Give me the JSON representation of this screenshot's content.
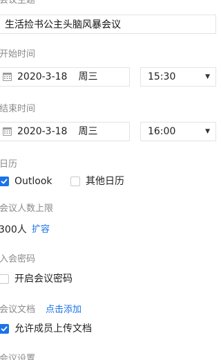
{
  "topic": {
    "label": "会议主题",
    "value": "生活捡书公主头脑风暴会议"
  },
  "start": {
    "label": "开始时间",
    "date": "2020-3-18",
    "weekday": "周三",
    "time": "15:30"
  },
  "end": {
    "label": "结束时间",
    "date": "2020-3-18",
    "weekday": "周三",
    "time": "16:00"
  },
  "calendar": {
    "label": "日历",
    "options": [
      {
        "label": "Outlook",
        "checked": true
      },
      {
        "label": "其他日历",
        "checked": false
      }
    ]
  },
  "capacity": {
    "label": "会议人数上限",
    "value": "300人",
    "expand_link": "扩容"
  },
  "password": {
    "label": "入会密码",
    "option_label": "开启会议密码",
    "checked": false
  },
  "documents": {
    "label": "会议文档",
    "add_link": "点击添加",
    "option_label": "允许成员上传文档",
    "checked": true
  },
  "settings": {
    "label": "会议设置"
  },
  "colors": {
    "accent": "#1a73e8",
    "label": "#8a8a8a",
    "border": "#e3e3e3"
  }
}
